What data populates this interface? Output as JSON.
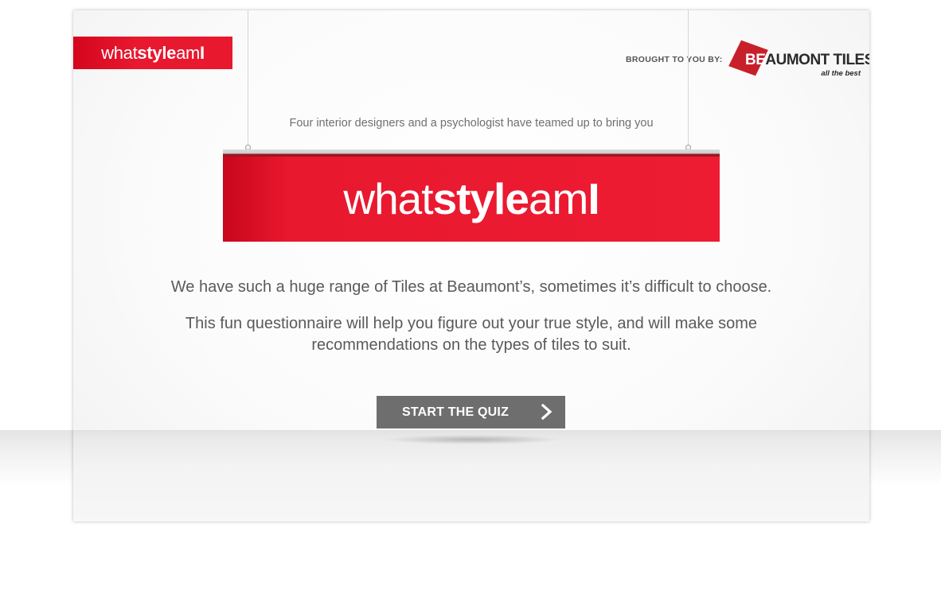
{
  "header": {
    "logo": {
      "what": "what",
      "style": "style",
      "am": "am",
      "i": "I"
    },
    "sponsor_label": "BROUGHT TO YOU BY:",
    "sponsor": {
      "name_be": "BE",
      "name_rest": "AUMONT TILES",
      "tagline": "all the best"
    }
  },
  "hero": {
    "tagline": "Four interior designers and a psychologist have teamed up to bring you",
    "title": {
      "what": "what",
      "style": "style",
      "am": "am",
      "i": "I"
    }
  },
  "content": {
    "lead": "We have such a huge range of Tiles at Beaumont’s, sometimes it’s difficult to choose.",
    "description": "This fun questionnaire will help you figure out your true style, and will make some recommendations on the types of tiles to suit."
  },
  "cta": {
    "label": "START THE QUIZ",
    "icon": "chevron-right-icon"
  },
  "colors": {
    "brand_red": "#e8182e",
    "button_gray": "#6e6e6e",
    "sponsor_red": "#c8202a"
  }
}
